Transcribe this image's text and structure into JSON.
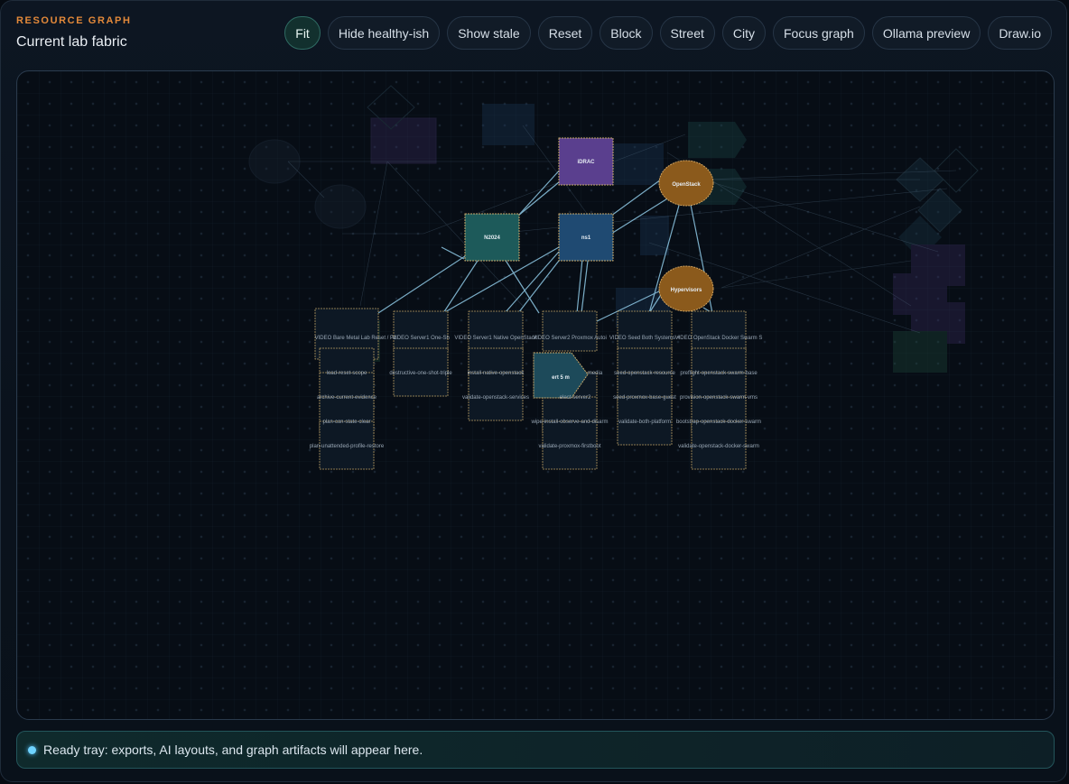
{
  "header": {
    "eyebrow": "RESOURCE GRAPH",
    "title": "Current lab fabric"
  },
  "toolbar": {
    "buttons": [
      {
        "label": "Fit",
        "active": true
      },
      {
        "label": "Hide healthy-ish",
        "active": false
      },
      {
        "label": "Show stale",
        "active": false
      },
      {
        "label": "Reset",
        "active": false
      },
      {
        "label": "Block",
        "active": false
      },
      {
        "label": "Street",
        "active": false
      },
      {
        "label": "City",
        "active": false
      },
      {
        "label": "Focus graph",
        "active": false
      },
      {
        "label": "Ollama preview",
        "active": false
      },
      {
        "label": "Draw.io",
        "active": false
      }
    ]
  },
  "graph": {
    "nodes": {
      "idrac": "iDRAC",
      "openstack": "OpenStack",
      "n2024": "N2024",
      "ns1": "ns1",
      "hypervisors": "Hypervisors",
      "server_pill": "ert 5 m"
    },
    "videos": [
      "VIDEO Bare Metal Lab Reset / P1",
      "VIDEO Server1 One-Sh",
      "VIDEO Server1 Native OpenStack",
      "VIDEO Server2 Proxmox Autoi",
      "VIDEO Seed Both Systems +",
      "VIDEO OpenStack Docker Swarm S"
    ],
    "tasks": [
      "lead-reset-scope",
      "archive-current-evidence",
      "plan-con-state-clear",
      "plan-unattended-profile-restore",
      "destructive-one-shot-triple",
      "install-native-openstack",
      "validate-openstack-services",
      "media",
      "elect-server2",
      "wipe-install-observe-and-disarm",
      "validate-proxmox-firstboot",
      "seed-openstack-resource",
      "seed-proxmox-base-guest",
      "validate-both-platform",
      "preflight-openstack-swarm-base",
      "provision-openstack-swarm-vms",
      "bootstrap-openstack-docker-swarm",
      "validate-openstack-docker-swarm"
    ]
  },
  "tray": {
    "message": "Ready tray: exports, AI layouts, and graph artifacts will appear here."
  },
  "colors": {
    "accent": "#e3893a",
    "teal": "#2f6b63",
    "node_teal": "#1d5a5a",
    "node_blue": "#1f4a72",
    "node_purple": "#5a3f8e",
    "node_orange": "#8b5a1c",
    "edge": "#8fc9e6"
  }
}
